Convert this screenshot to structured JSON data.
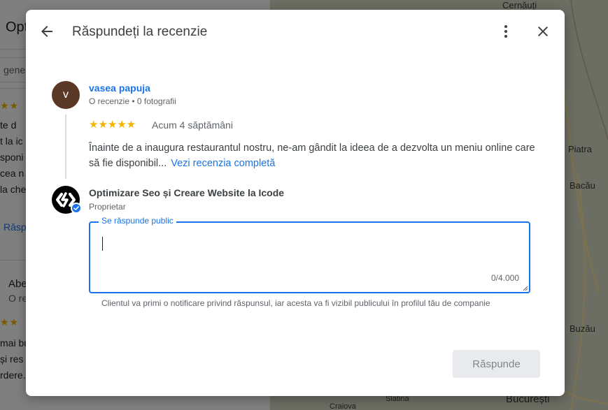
{
  "background": {
    "panel_title": "Opt",
    "filter_chip": "gene",
    "snippets": [
      "te d",
      "t la ic",
      "sponi",
      "cea n",
      "la che"
    ],
    "reply_link": "Răsp",
    "second_reviewer": "Abe",
    "second_meta": "O re",
    "second_snippets": [
      "mai bu",
      "și res",
      "rdere."
    ],
    "map_labels": [
      "Cernăuți",
      "Piatra",
      "Bacău",
      "Buzău",
      "București",
      "Slatina",
      "Craiova"
    ]
  },
  "dialog": {
    "title": "Răspundeți la recenzie",
    "icons": {
      "back": "arrow-back-icon",
      "more": "more-vert-icon",
      "close": "close-icon"
    }
  },
  "review": {
    "avatar_letter": "v",
    "author": "vasea papuja",
    "meta": "O recenzie • 0 fotografii",
    "stars": "★★★★★",
    "rating": 5,
    "date": "Acum 4 săptămâni",
    "text": "Înainte de a inaugura restaurantul nostru, ne-am gândit la ideea de a dezvolta un meniu online care să fie disponibil...",
    "full_link": "Vezi recenzia completă"
  },
  "owner": {
    "name": "Optimizare Seo și Creare Website la Icode",
    "role": "Proprietar",
    "verified": true
  },
  "reply": {
    "label": "Se răspunde public",
    "value": "",
    "char_count": "0/4.000",
    "helper": "Clientul va primi o notificare privind răspunsul, iar acesta va fi vizibil publicului în profilul tău de companie",
    "submit_label": "Răspunde"
  },
  "colors": {
    "accent": "#1a73e8",
    "star": "#f4b400",
    "avatar_bg": "#5a3826",
    "disabled_btn": "#e8eaed"
  }
}
